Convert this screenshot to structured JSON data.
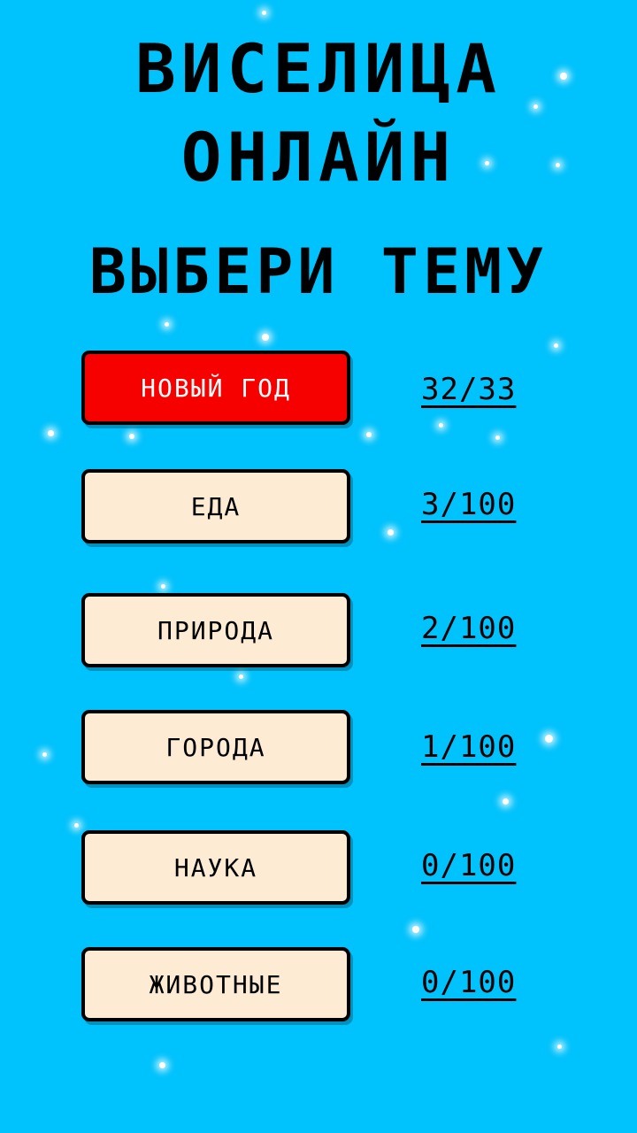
{
  "header": {
    "title_line1": "ВИСЕЛИЦА",
    "title_line2": "ОНЛАЙН",
    "subtitle": "ВЫБЕРИ ТЕМУ"
  },
  "colors": {
    "background": "#00c2fc",
    "button": "#fdebd3",
    "active_button": "#f70000"
  },
  "topics": [
    {
      "label": "НОВЫЙ ГОД",
      "score": "32/33",
      "active": true
    },
    {
      "label": "ЕДА",
      "score": "3/100",
      "active": false
    },
    {
      "label": "ПРИРОДА",
      "score": "2/100",
      "active": false
    },
    {
      "label": "ГОРОДА",
      "score": "1/100",
      "active": false
    },
    {
      "label": "НАУКА",
      "score": "0/100",
      "active": false
    },
    {
      "label": "ЖИВОТНЫЕ",
      "score": "0/100",
      "active": false
    }
  ]
}
